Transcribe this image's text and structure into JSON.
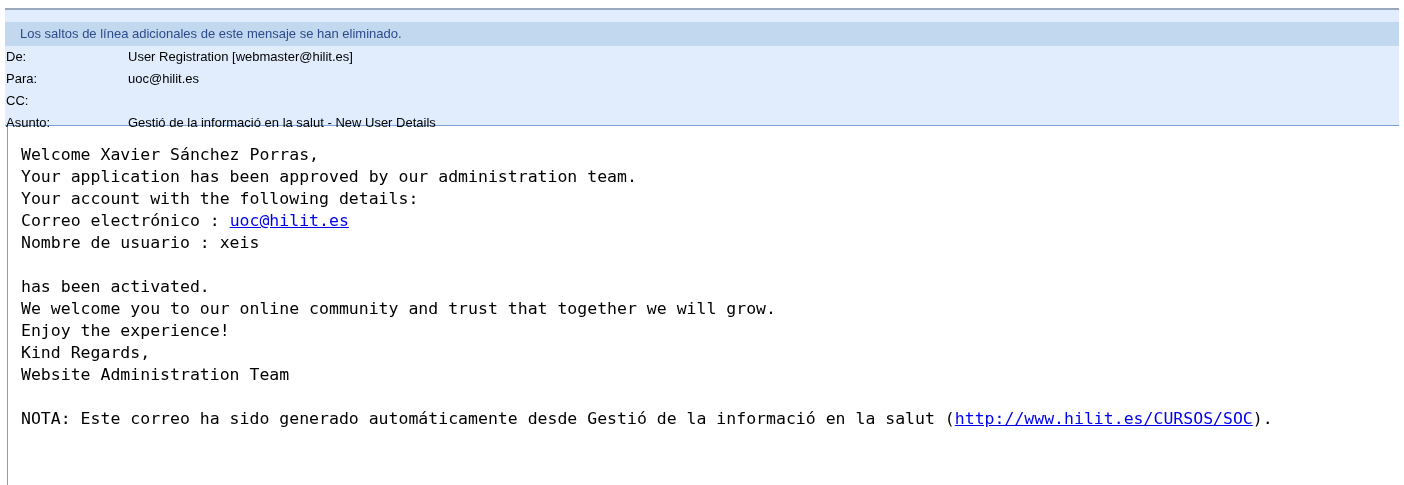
{
  "info_bar": "Los saltos de línea adicionales de este mensaje se han eliminado.",
  "header_fields": [
    {
      "label": "De:",
      "value": "User Registration [webmaster@hilit.es]"
    },
    {
      "label": "Para:",
      "value": "uoc@hilit.es"
    },
    {
      "label": "CC:"
    },
    {
      "label": "Asunto:",
      "value": "Gestió de la informació en la salut - New User Details"
    }
  ],
  "body": {
    "paragraphs": [
      [
        {
          "text": "Welcome Xavier Sánchez Porras,"
        },
        {
          "text": "Your application has been approved by our administration team."
        },
        {
          "text": "Your account with the following details:"
        },
        {
          "text": "Correo electrónico : ",
          "link": "uoc@hilit.es"
        },
        {
          "text": "Nombre de usuario : xeis"
        }
      ],
      [
        {
          "text": "has been activated."
        },
        {
          "text": "We welcome you to our online community and trust that together we will grow."
        },
        {
          "text": "Enjoy the experience!"
        },
        {
          "text": "Kind Regards,"
        },
        {
          "text": "Website Administration Team"
        }
      ],
      [
        {
          "text": "NOTA: Este correo ha sido generado automáticamente desde Gestió de la informació en la salut (",
          "link": "http://www.hilit.es/CURSOS/SOC",
          "after": ")."
        }
      ]
    ]
  }
}
